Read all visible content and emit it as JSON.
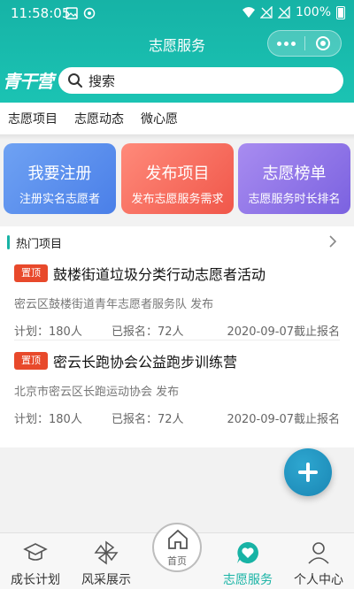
{
  "status_bar": {
    "time": "11:58:05",
    "battery": "100%"
  },
  "header": {
    "title": "志愿服务",
    "logo": "青干营"
  },
  "search": {
    "placeholder": "搜索"
  },
  "tabs": [
    {
      "label": "志愿项目",
      "active": true
    },
    {
      "label": "志愿动态",
      "active": false
    },
    {
      "label": "微心愿",
      "active": false
    }
  ],
  "cards": [
    {
      "title": "我要注册",
      "subtitle": "注册实名志愿者"
    },
    {
      "title": "发布项目",
      "subtitle": "发布志愿服务需求"
    },
    {
      "title": "志愿榜单",
      "subtitle": "志愿服务时长排名"
    }
  ],
  "hot": {
    "title": "热门项目",
    "items": [
      {
        "tag": "置顶",
        "title": "鼓楼街道垃圾分类行动志愿者活动",
        "org": "密云区鼓楼街道青年志愿者服务队 发布",
        "plan": "计划：180人",
        "applied": "已报名：72人",
        "deadline": "2020-09-07截止报名"
      },
      {
        "tag": "置顶",
        "title": "密云长跑协会公益跑步训练营",
        "org": "北京市密云区长跑运动协会 发布",
        "plan": "计划：180人",
        "applied": "已报名：72人",
        "deadline": "2020-09-07截止报名"
      }
    ]
  },
  "bottom_nav": [
    {
      "label": "成长计划",
      "icon": "graduation-cap-icon"
    },
    {
      "label": "风采展示",
      "icon": "pinwheel-icon"
    },
    {
      "label": "首页",
      "icon": "home-icon"
    },
    {
      "label": "志愿服务",
      "icon": "heart-chat-icon",
      "active": true
    },
    {
      "label": "个人中心",
      "icon": "user-icon"
    }
  ],
  "colors": {
    "accent": "#18b3a5",
    "header": "#1bc3b3",
    "tag": "#e8492b"
  }
}
